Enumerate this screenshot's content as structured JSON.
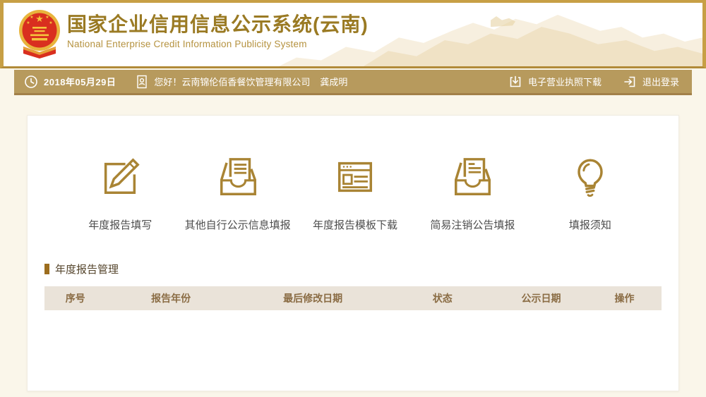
{
  "header": {
    "title": "国家企业信用信息公示系统(云南)",
    "subtitle": "National Enterprise Credit Information Publicity System",
    "logo": "china-national-emblem"
  },
  "topbar": {
    "date": "2018年05月29日",
    "greeting": "您好！云南锦伦佰香餐饮管理有限公司",
    "username": "龚成明",
    "license_download_label": "电子营业执照下载",
    "logout_label": "退出登录"
  },
  "menu": {
    "items": [
      {
        "label": "年度报告填写",
        "icon": "edit-report-icon"
      },
      {
        "label": "其他自行公示信息填报",
        "icon": "inbox-document-icon"
      },
      {
        "label": "年度报告模板下载",
        "icon": "template-download-icon"
      },
      {
        "label": "简易注销公告填报",
        "icon": "inbox-announcement-icon"
      },
      {
        "label": "填报须知",
        "icon": "lightbulb-icon"
      }
    ]
  },
  "report_section": {
    "title": "年度报告管理",
    "table": {
      "columns": [
        "序号",
        "报告年份",
        "最后修改日期",
        "状态",
        "公示日期",
        "操作"
      ],
      "rows": []
    }
  },
  "colors": {
    "gold_accent": "#a98434",
    "navbar_bg": "#b79a5d",
    "page_bg": "#faf6ea",
    "header_border": "#c79f45",
    "table_header_bg": "#eae3d9",
    "table_header_text": "#8a6c44",
    "title_gold": "#9a7a23",
    "emblem_red": "#d92f1f"
  }
}
